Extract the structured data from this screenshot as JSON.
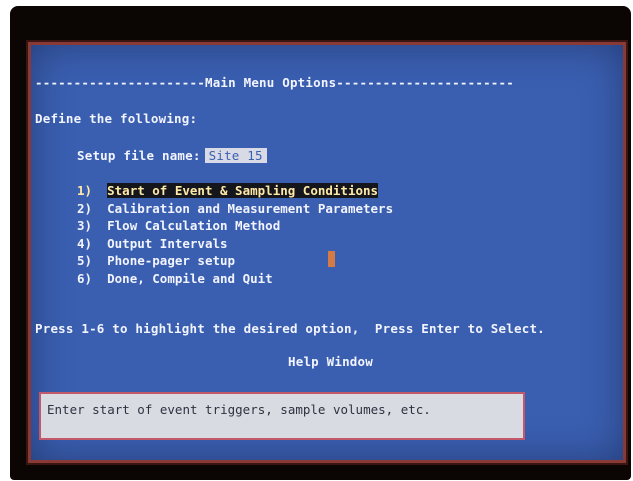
{
  "header": {
    "title": "----------------------Main Menu Options-----------------------"
  },
  "prompt": {
    "define_label": "Define the following:"
  },
  "setup": {
    "label": "Setup file name:",
    "value": "Site 15"
  },
  "menu": {
    "items": [
      {
        "num": "1)",
        "label": "Start of Event & Sampling Conditions",
        "selected": true
      },
      {
        "num": "2)",
        "label": "Calibration and Measurement Parameters",
        "selected": false
      },
      {
        "num": "3)",
        "label": "Flow Calculation Method",
        "selected": false
      },
      {
        "num": "4)",
        "label": "Output Intervals",
        "selected": false
      },
      {
        "num": "5)",
        "label": "Phone-pager setup",
        "selected": false
      },
      {
        "num": "6)",
        "label": "Done, Compile and Quit",
        "selected": false
      }
    ]
  },
  "instructions": {
    "text": "Press 1-6 to highlight the desired option,  Press Enter to Select."
  },
  "help": {
    "title": "Help Window",
    "text": "Enter start of event triggers, sample volumes, etc."
  },
  "colors": {
    "screen_bg": "#3a5fb1",
    "text": "#f2f4ff",
    "highlight_bg": "#15161c",
    "highlight_text": "#ffe9a8",
    "help_bg": "#d9dbe3",
    "frame": "#8a3a34",
    "cursor": "#d47a45"
  }
}
